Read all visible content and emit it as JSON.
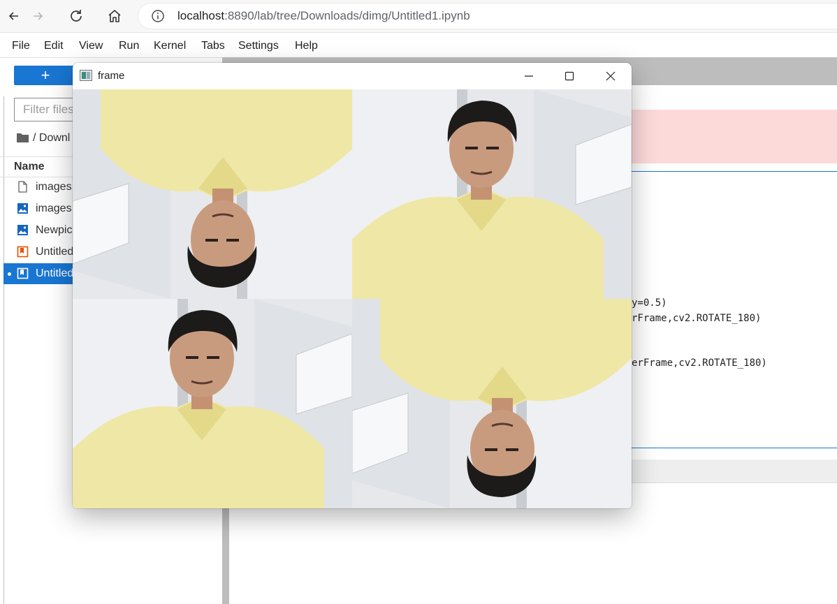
{
  "browser": {
    "url_host": "localhost",
    "url_path": ":8890/lab/tree/Downloads/dimg/Untitled1.ipynb",
    "icons": [
      "back-icon",
      "forward-icon",
      "reload-icon",
      "home-icon",
      "info-icon"
    ]
  },
  "menu": {
    "items": [
      "File",
      "Edit",
      "View",
      "Run",
      "Kernel",
      "Tabs",
      "Settings",
      "Help"
    ]
  },
  "filebrowser": {
    "new_label": "+",
    "filter_placeholder": "Filter files",
    "breadcrumb": "/ Downl",
    "column_name": "Name",
    "files": [
      {
        "name": "images.",
        "icon": "file-icon"
      },
      {
        "name": "images.",
        "icon": "image-icon"
      },
      {
        "name": "Newpic",
        "icon": "image-icon"
      },
      {
        "name": "Untitled",
        "icon": "notebook-icon"
      },
      {
        "name": "Untitled",
        "icon": "notebook-icon",
        "selected": true,
        "running": true
      }
    ]
  },
  "notebook": {
    "code_lines": [
      {
        "text": "y=0.5)"
      },
      {
        "text": "rFrame,cv2.ROTATE_180)"
      },
      {
        "text": "erFrame,cv2.ROTATE_180)"
      }
    ]
  },
  "cv_window": {
    "title": "frame",
    "controls": [
      "minimize-icon",
      "maximize-icon",
      "close-icon"
    ],
    "quadrants": [
      {
        "position": "top-left",
        "rotated": true
      },
      {
        "position": "top-right",
        "rotated": false
      },
      {
        "position": "bottom-left",
        "rotated": false
      },
      {
        "position": "bottom-right",
        "rotated": true
      }
    ]
  },
  "colors": {
    "accent": "#1976d2",
    "shirt": "#efe7a6",
    "wall": "#e6e8eb",
    "error_bg": "#fddada"
  }
}
